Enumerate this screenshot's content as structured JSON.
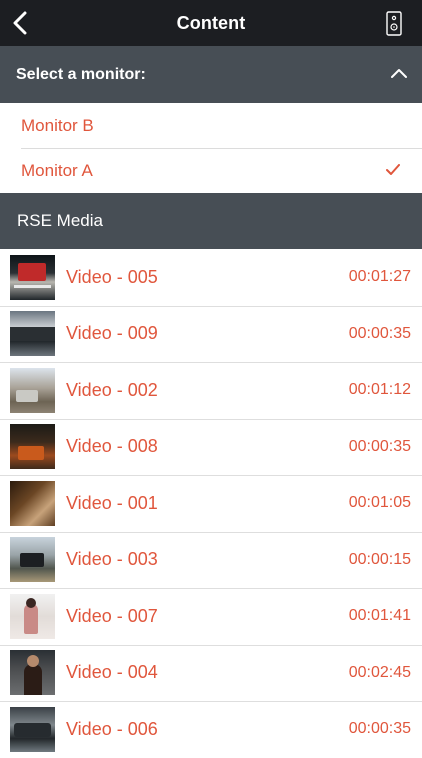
{
  "navbar": {
    "title": "Content",
    "back_icon": "chevron-left-icon",
    "remote_icon": "remote-control-icon"
  },
  "monitor_selector": {
    "header_label": "Select a monitor:",
    "expanded": true,
    "options": [
      {
        "label": "Monitor B",
        "selected": false
      },
      {
        "label": "Monitor A",
        "selected": true
      }
    ]
  },
  "section": {
    "label": "RSE Media"
  },
  "videos": [
    {
      "title": "Video - 005",
      "duration": "00:01:27"
    },
    {
      "title": "Video - 009",
      "duration": "00:00:35"
    },
    {
      "title": "Video - 002",
      "duration": "00:01:12"
    },
    {
      "title": "Video - 008",
      "duration": "00:00:35"
    },
    {
      "title": "Video - 001",
      "duration": "00:01:05"
    },
    {
      "title": "Video - 003",
      "duration": "00:00:15"
    },
    {
      "title": "Video - 007",
      "duration": "00:01:41"
    },
    {
      "title": "Video - 004",
      "duration": "00:02:45"
    },
    {
      "title": "Video - 006",
      "duration": "00:00:35"
    }
  ],
  "colors": {
    "accent": "#e0563c",
    "navbar": "#1c1e22",
    "header": "#474e55"
  }
}
